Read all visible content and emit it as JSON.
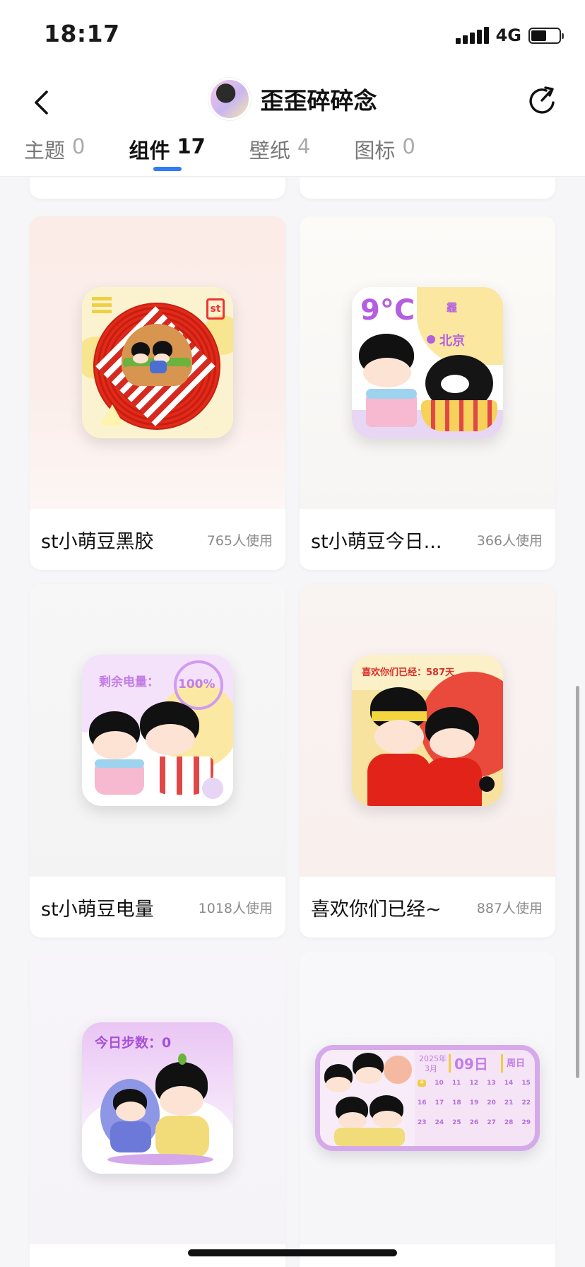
{
  "status_bar": {
    "time": "18:17",
    "network": "4G",
    "battery_level": 0.55
  },
  "nav": {
    "title": "歪歪碎碎念"
  },
  "tabs": [
    {
      "label": "主题",
      "count": "0",
      "active": false
    },
    {
      "label": "组件",
      "count": "17",
      "active": true
    },
    {
      "label": "壁纸",
      "count": "4",
      "active": false
    },
    {
      "label": "图标",
      "count": "0",
      "active": false
    }
  ],
  "cards": [
    {
      "name": "st小萌豆黑胶",
      "usage": "765人使用",
      "theme": "vinyl-burger"
    },
    {
      "name": "st小萌豆今日...",
      "usage": "366人使用",
      "theme": "weather",
      "widget_text": {
        "temp": "9°C",
        "condition": "霾",
        "city": "北京"
      }
    },
    {
      "name": "st小萌豆电量",
      "usage": "1018人使用",
      "theme": "battery",
      "widget_text": {
        "label": "剩余电量：",
        "percent": "100%"
      }
    },
    {
      "name": "喜欢你们已经~",
      "usage": "887人使用",
      "theme": "days",
      "widget_text": {
        "label": "喜欢你们已经：587天"
      }
    },
    {
      "name": "",
      "usage": "",
      "theme": "steps",
      "widget_text": {
        "label": "今日步数：0"
      }
    },
    {
      "name": "",
      "usage": "",
      "theme": "calendar",
      "widget_text": {
        "year": "2025年",
        "month": "3月",
        "day": "09日",
        "weekday": "周日",
        "dates_row1": [
          "10",
          "11",
          "12",
          "13",
          "14",
          "15"
        ],
        "dates_row2": [
          "16",
          "17",
          "18",
          "19",
          "20",
          "21",
          "22"
        ],
        "dates_row3": [
          "23",
          "24",
          "25",
          "26",
          "27",
          "28",
          "29"
        ]
      }
    }
  ],
  "colors": {
    "accent": "#2f7cf6",
    "usage_gray": "#8a8a8a"
  }
}
